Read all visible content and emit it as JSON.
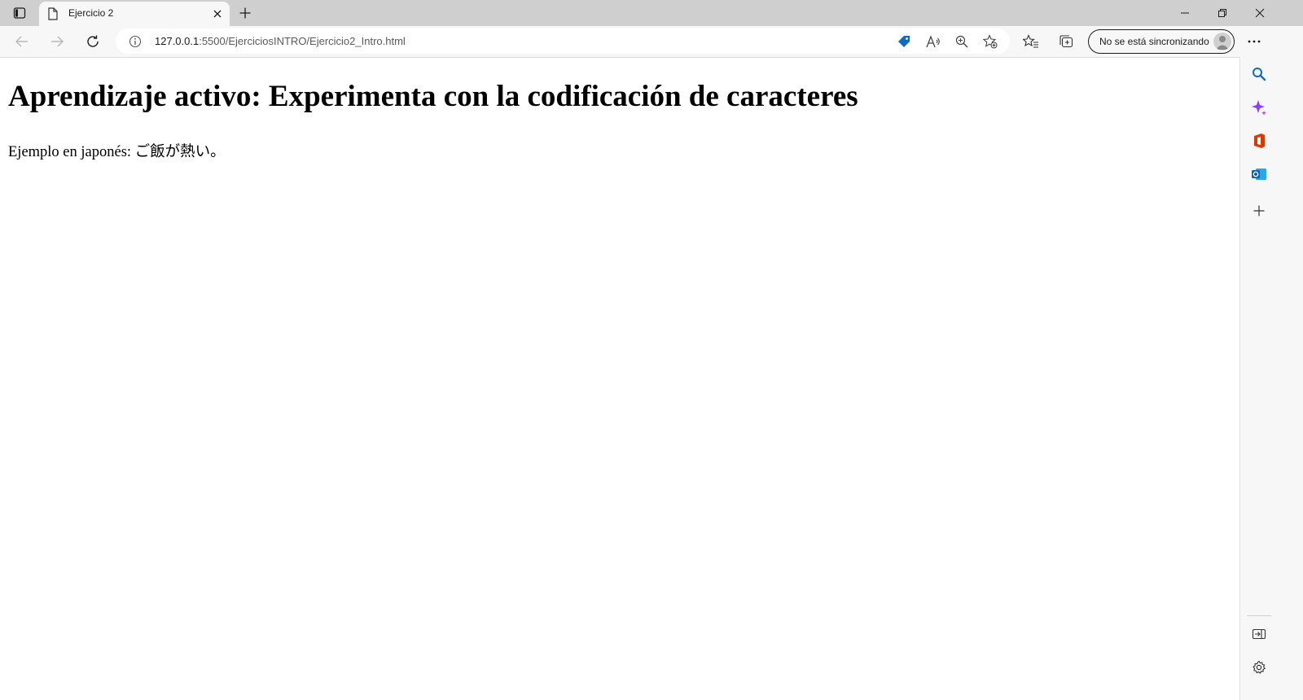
{
  "browser": {
    "tab": {
      "title": "Ejercicio 2"
    },
    "address": {
      "host": "127.0.0.1",
      "path": ":5500/EjerciciosINTRO/Ejercicio2_Intro.html"
    },
    "profile": {
      "label": "No se está sincronizando"
    },
    "icons": {
      "tab_actions": "tab-actions-icon",
      "favicon": "page-icon",
      "close": "close-icon",
      "new_tab": "plus-icon",
      "back": "back-arrow-icon",
      "forward": "forward-arrow-icon",
      "refresh": "refresh-icon",
      "site_info": "info-icon",
      "shopping": "price-tag-icon",
      "read_aloud": "read-aloud-icon",
      "zoom": "zoom-icon",
      "add_favorite": "star-add-icon",
      "favorites": "favorites-icon",
      "collections": "collections-icon",
      "menu": "more-icon"
    },
    "accent_color": "#0f6cbd"
  },
  "sidebar": {
    "items": [
      "search-icon",
      "copilot-icon",
      "office-icon",
      "outlook-icon",
      "add-icon"
    ],
    "bottom": [
      "hide-sidebar-icon",
      "settings-icon"
    ]
  },
  "page": {
    "heading": "Aprendizaje activo: Experimenta con la codificación de caracteres",
    "paragraph": "Ejemplo en japonés: ご飯が熱い。"
  }
}
